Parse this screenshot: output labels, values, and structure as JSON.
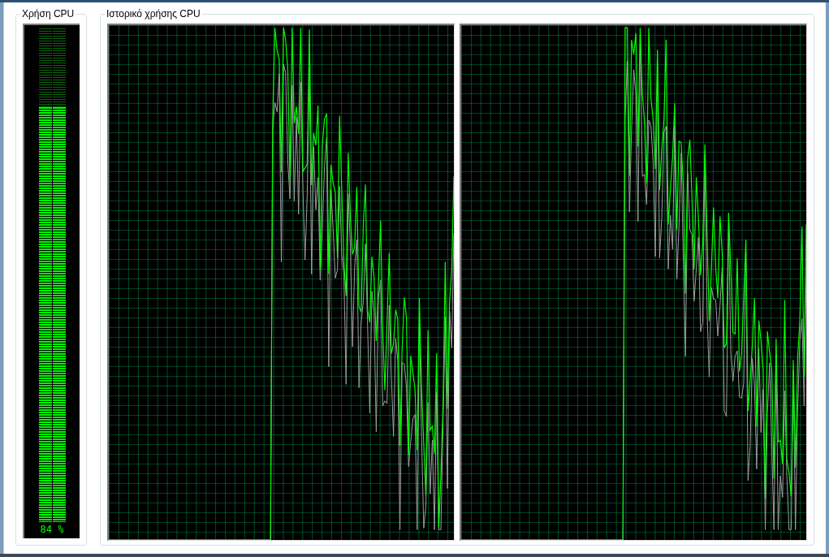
{
  "usage": {
    "title": "Χρήση CPU",
    "level": 0.84,
    "reading": "84 %"
  },
  "history": {
    "title": "Ιστορικό χρήσης CPU"
  }
}
